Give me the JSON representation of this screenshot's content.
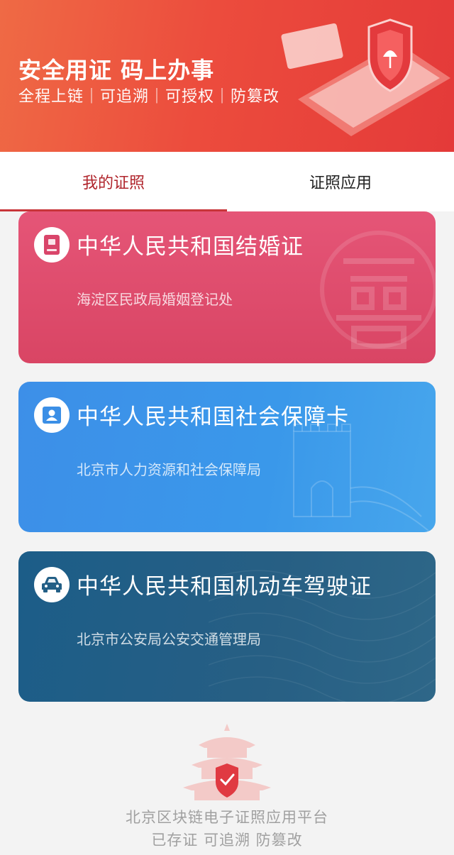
{
  "banner": {
    "title": "安全用证 码上办事",
    "subtitle": "全程上链｜可追溯｜可授权｜防篡改"
  },
  "tabs": [
    {
      "label": "我的证照",
      "active": true
    },
    {
      "label": "证照应用",
      "active": false
    }
  ],
  "cards": [
    {
      "title": "中华人民共和国结婚证",
      "issuer": "海淀区民政局婚姻登记处",
      "icon": "passport-icon",
      "color": "#e04f70"
    },
    {
      "title": "中华人民共和国社会保障卡",
      "issuer": "北京市人力资源和社会保障局",
      "icon": "id-card-icon",
      "color": "#3d92e9"
    },
    {
      "title": "中华人民共和国机动车驾驶证",
      "issuer": "北京市公安局公安交通管理局",
      "icon": "car-icon",
      "color": "#225f86"
    }
  ],
  "footer": {
    "line1": "北京区块链电子证照应用平台",
    "line2": "已存证 可追溯 防篡改"
  },
  "colors": {
    "accent": "#c8353a",
    "banner": "#ec4c3d"
  }
}
